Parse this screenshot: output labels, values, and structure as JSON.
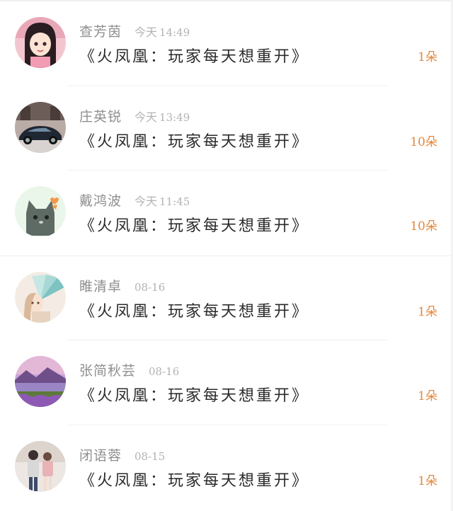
{
  "gifts": [
    {
      "name": "查芳茵",
      "day": "今天",
      "time": "14:49",
      "book_title": "《火凤凰：玩家每天想重开》",
      "count": "1朵",
      "avatar": "anime-girl-avatar"
    },
    {
      "name": "庄英锐",
      "day": "今天",
      "time": "13:49",
      "book_title": "《火凤凰：玩家每天想重开》",
      "count": "10朵",
      "avatar": "sports-car-avatar"
    },
    {
      "name": "戴鸿波",
      "day": "今天",
      "time": "11:45",
      "book_title": "《火凤凰：玩家每天想重开》",
      "count": "10朵",
      "avatar": "cat-avatar"
    },
    {
      "name": "睢清卓",
      "day": "",
      "time": "08-16",
      "book_title": "《火凤凰：玩家每天想重开》",
      "count": "1朵",
      "avatar": "fan-girl-avatar"
    },
    {
      "name": "张简秋芸",
      "day": "",
      "time": "08-16",
      "book_title": "《火凤凰：玩家每天想重开》",
      "count": "1朵",
      "avatar": "lake-landscape-avatar"
    },
    {
      "name": "闭语蓉",
      "day": "",
      "time": "08-15",
      "book_title": "《火凤凰：玩家每天想重开》",
      "count": "1朵",
      "avatar": "couple-photo-avatar"
    }
  ],
  "colors": {
    "name": "#8f8f8f",
    "time": "#b3b3b3",
    "title": "#2b2b2b",
    "count": "#e5873b"
  }
}
